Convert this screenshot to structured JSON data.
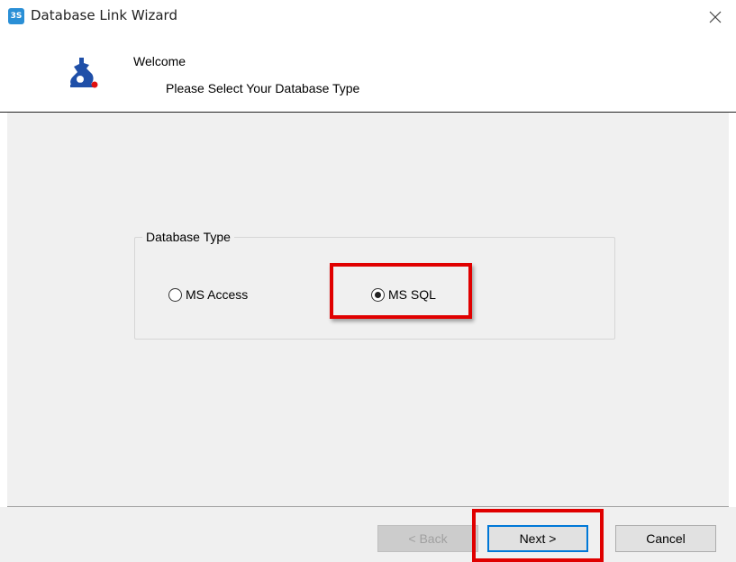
{
  "window": {
    "icon_text": "3S",
    "title": "Database Link Wizard",
    "close_icon": "close-icon"
  },
  "header": {
    "logo_icon": "app-logo-icon",
    "welcome": "Welcome",
    "subtitle": "Please Select Your Database Type"
  },
  "database_type": {
    "legend": "Database Type",
    "options": [
      {
        "label": "MS Access",
        "selected": false
      },
      {
        "label": "MS SQL",
        "selected": true
      }
    ]
  },
  "buttons": {
    "back": "< Back",
    "next": "Next >",
    "cancel": "Cancel"
  },
  "colors": {
    "highlight": "#e00000",
    "focus_border": "#0078d7",
    "panel_bg": "#f0f0f0"
  }
}
